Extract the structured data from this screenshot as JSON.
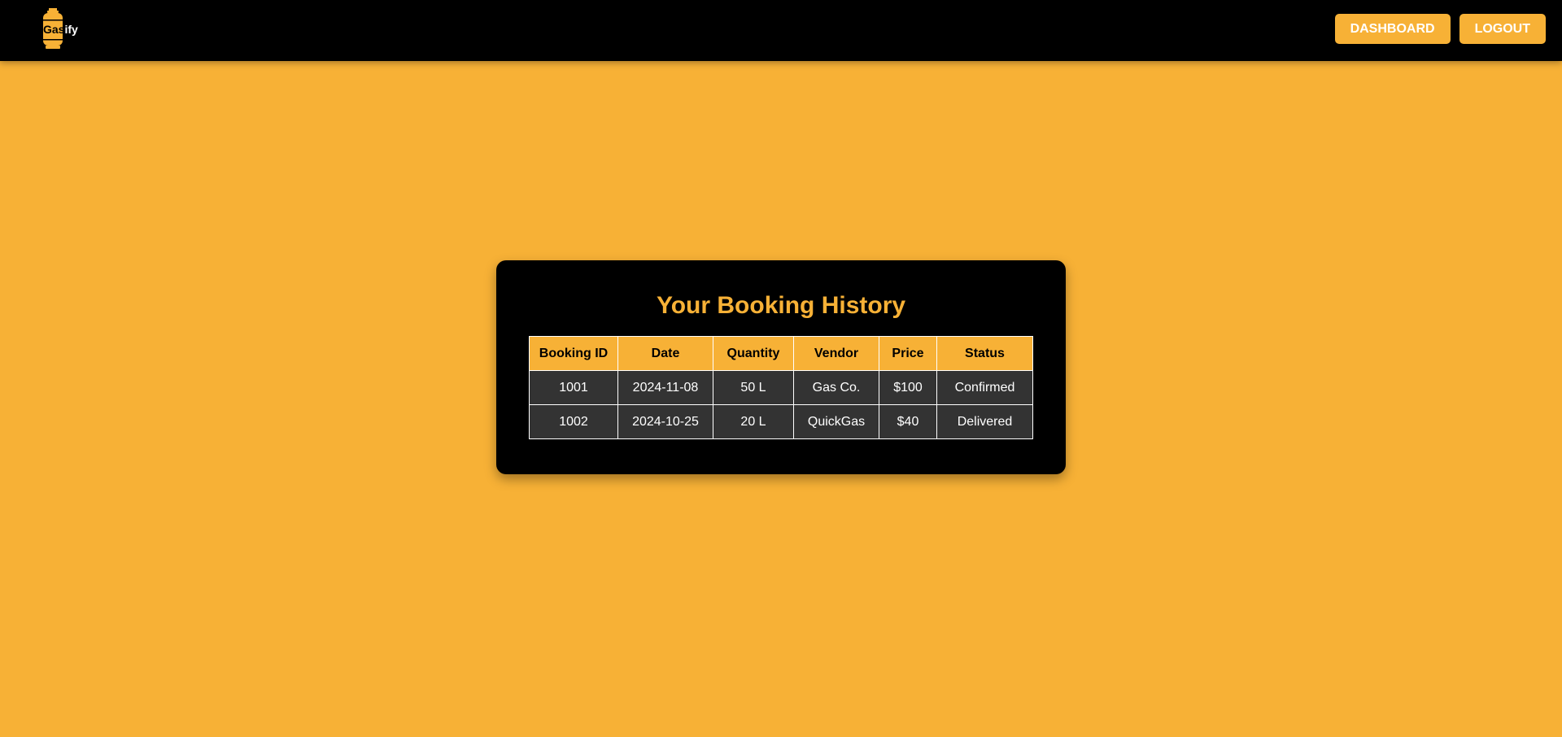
{
  "brand": {
    "prefix": "Gas",
    "suffix": "ify",
    "accent_color": "#f7b136",
    "icon": "gas-cylinder-icon"
  },
  "nav": {
    "dashboard_label": "DASHBOARD",
    "logout_label": "LOGOUT"
  },
  "main": {
    "title": "Your Booking History",
    "table": {
      "headers": [
        "Booking ID",
        "Date",
        "Quantity",
        "Vendor",
        "Price",
        "Status"
      ],
      "rows": [
        [
          "1001",
          "2024-11-08",
          "50 L",
          "Gas Co.",
          "$100",
          "Confirmed"
        ],
        [
          "1002",
          "2024-10-25",
          "20 L",
          "QuickGas",
          "$40",
          "Delivered"
        ]
      ]
    }
  },
  "colors": {
    "page_background": "#f7b136",
    "navbar_background": "#000000",
    "card_background": "#000000",
    "row_background": "#333333"
  }
}
